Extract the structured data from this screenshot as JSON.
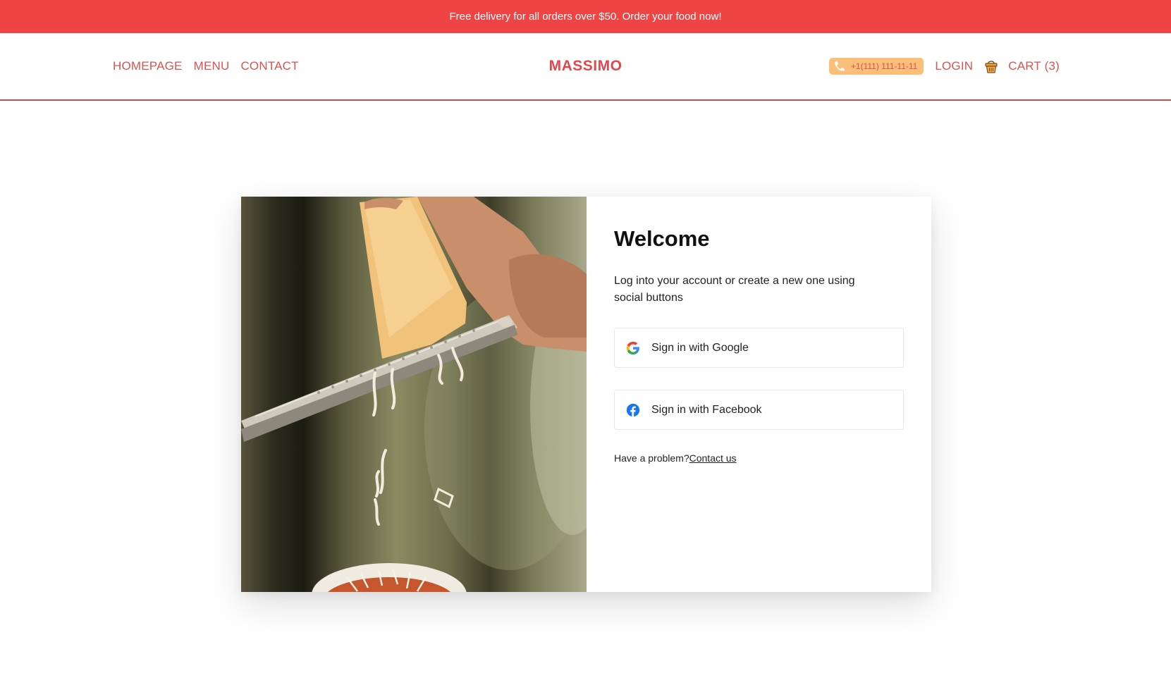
{
  "promo": {
    "text": "Free delivery for all orders over $50. Order your food now!"
  },
  "nav": {
    "left": [
      "HOMEPAGE",
      "MENU",
      "CONTACT"
    ],
    "logo": "MASSIMO",
    "phone": "+1(111) 111-11-11",
    "login": "LOGIN",
    "cart": "CART (3)"
  },
  "login_card": {
    "title": "Welcome",
    "description": "Log into your account or create a new one using social buttons",
    "google_label": "Sign in with Google",
    "facebook_label": "Sign in with Facebook",
    "problem_text": "Have a problem?",
    "contact_link": "Contact us"
  },
  "colors": {
    "accent": "#ef4444",
    "phone_badge": "#fbbf7a",
    "facebook_blue": "#1877f2"
  },
  "icons": [
    "phone-icon",
    "cart-icon",
    "google-icon",
    "facebook-icon"
  ]
}
